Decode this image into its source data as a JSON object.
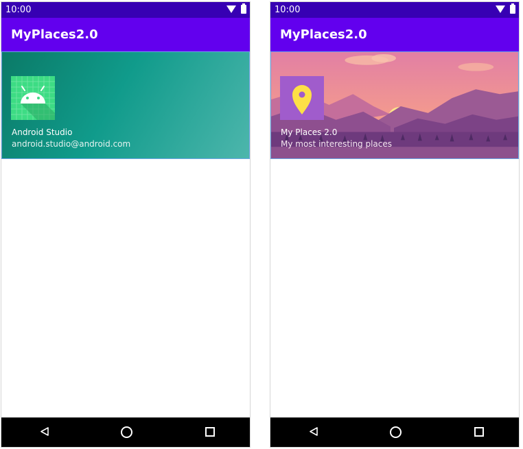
{
  "left": {
    "status_time": "10:00",
    "app_title": "MyPlaces2.0",
    "header": {
      "name": "Android Studio",
      "email": "android.studio@android.com",
      "icon": "android-robot-icon"
    }
  },
  "right": {
    "status_time": "10:00",
    "app_title": "MyPlaces2.0",
    "header": {
      "name": "My Places 2.0",
      "subtitle": "My most interesting places",
      "icon": "map-pin-icon",
      "background": "mountain-sunset-landscape"
    }
  },
  "colors": {
    "status_bar": "#3700b3",
    "app_bar": "#6200ee",
    "nav_bar": "#000000",
    "pin_yellow": "#fde047",
    "pin_bg": "#a05ccc"
  }
}
